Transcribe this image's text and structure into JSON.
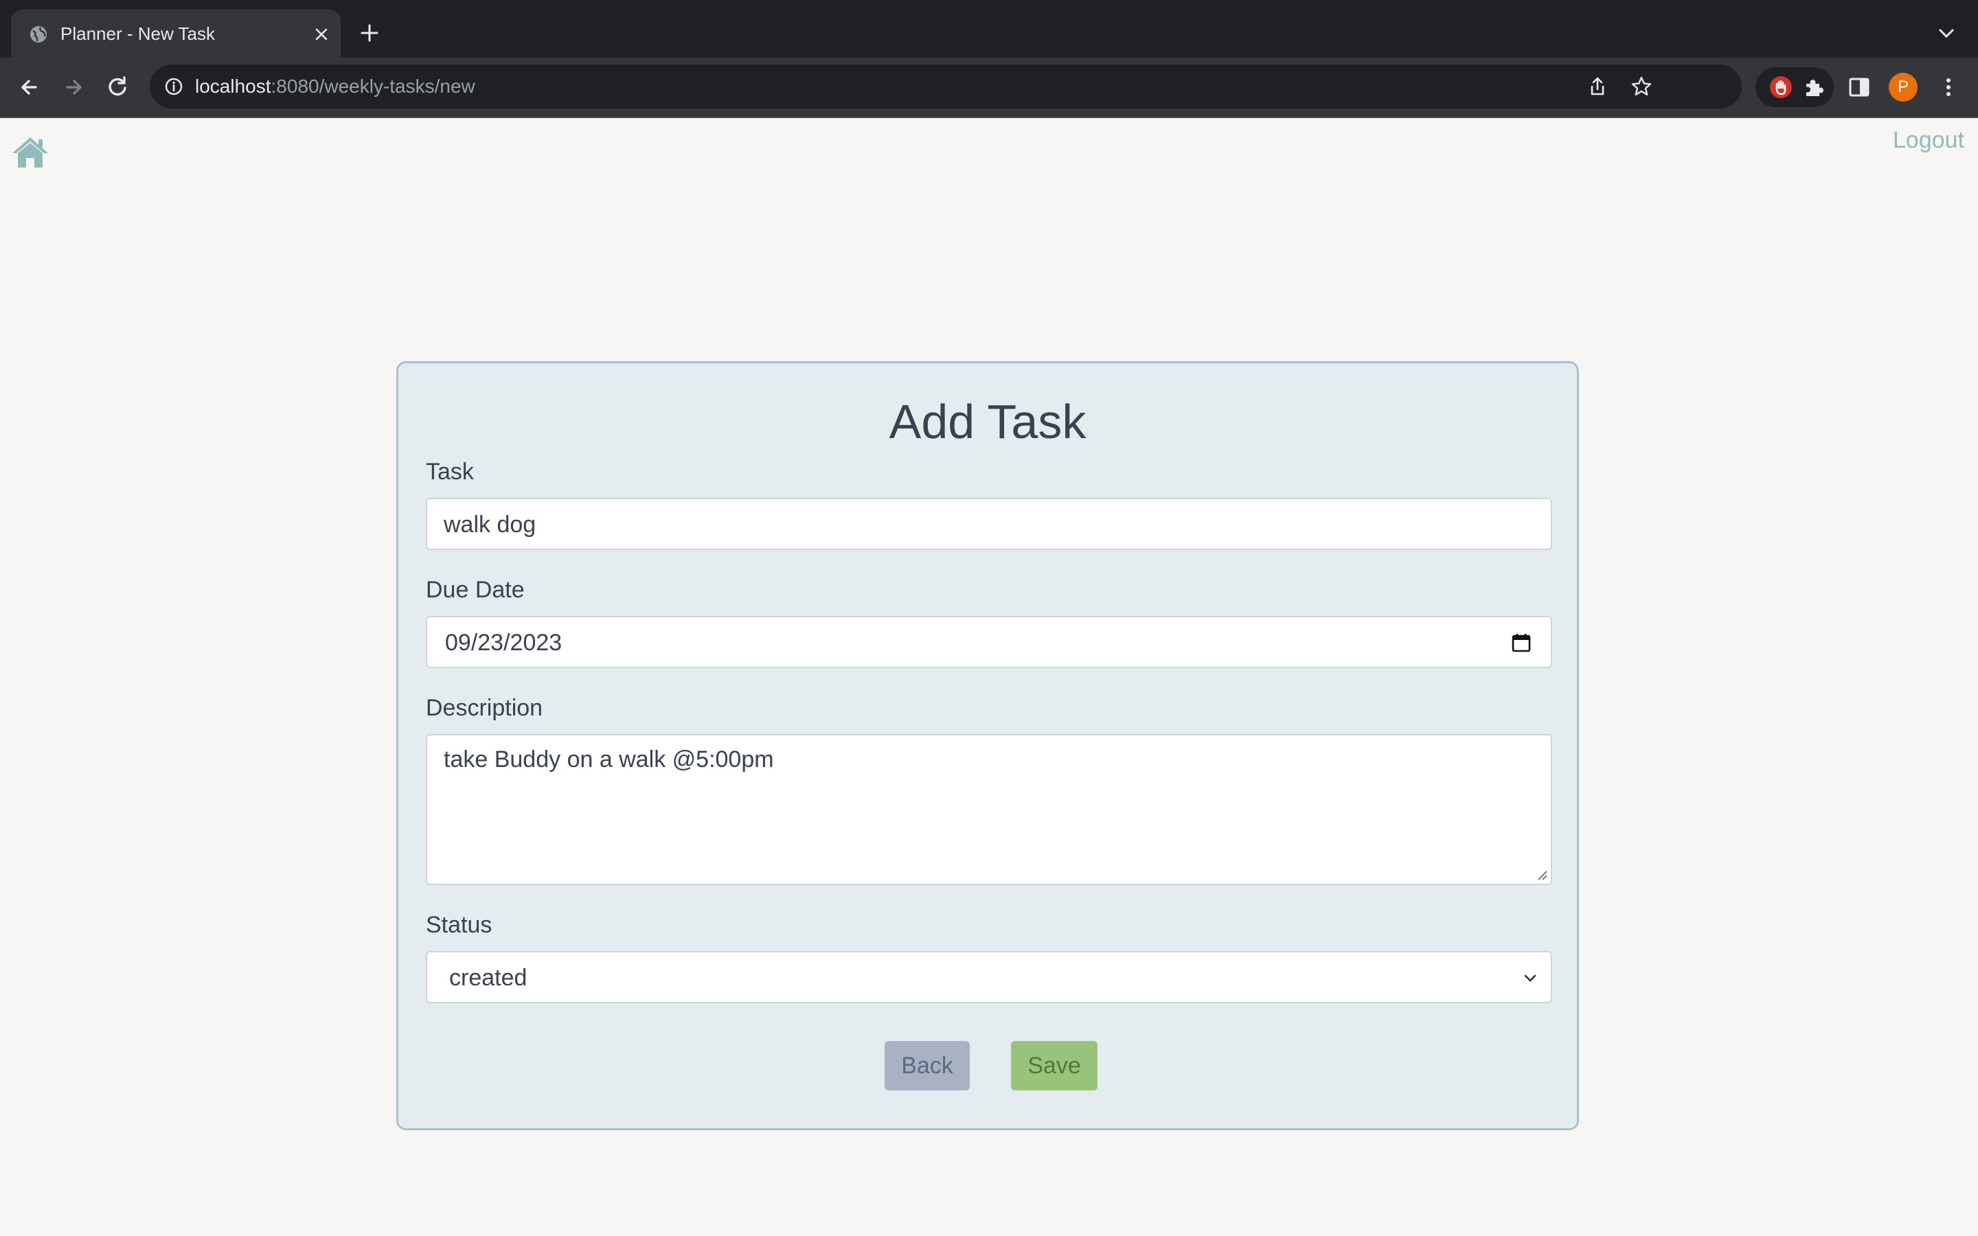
{
  "browser": {
    "tab_title": "Planner - New Task",
    "url_host": "localhost",
    "url_rest": ":8080/weekly-tasks/new",
    "profile_initial": "P"
  },
  "icons": {
    "tab": "globe-icon",
    "close": "close-icon",
    "new_tab": "plus-icon",
    "back": "arrow-left-icon",
    "forward": "arrow-right-icon",
    "reload": "reload-icon",
    "info": "info-icon",
    "share": "share-icon",
    "bookmark": "star-icon",
    "extension_blocker": "hand-stop-icon",
    "extensions": "puzzle-icon",
    "side_panel": "side-panel-icon",
    "menu": "kebab-menu-icon",
    "home": "home-icon",
    "calendar": "calendar-icon",
    "select": "chevron-down-icon"
  },
  "nav": {
    "logout_label": "Logout"
  },
  "form": {
    "title": "Add Task",
    "task_label": "Task",
    "task_value": "walk dog",
    "due_date_label": "Due Date",
    "due_date_value": "09/23/2023",
    "description_label": "Description",
    "description_value": "take Buddy on a walk @5:00pm",
    "status_label": "Status",
    "status_value": "created",
    "back_label": "Back",
    "save_label": "Save"
  },
  "colors": {
    "accent": "#8fbcbb",
    "card_bg": "#e4ecef",
    "back_button": "#a9b2c2",
    "save_button": "#98c37a"
  }
}
